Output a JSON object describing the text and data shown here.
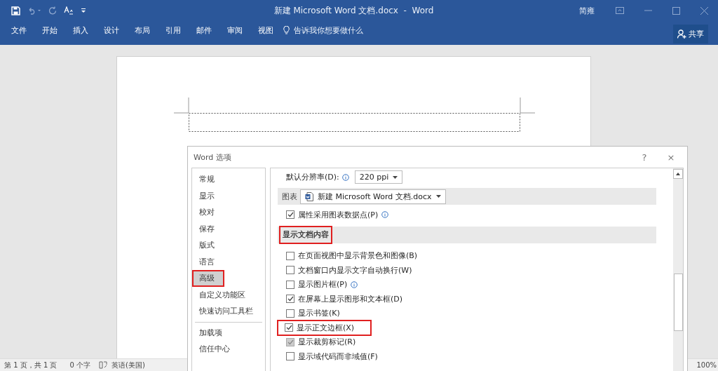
{
  "title_bar": {
    "title": "新建 Microsoft Word 文档.docx  -  Word",
    "user": "简雍"
  },
  "ribbon": {
    "tabs": [
      "文件",
      "开始",
      "插入",
      "设计",
      "布局",
      "引用",
      "邮件",
      "审阅",
      "视图"
    ],
    "tell_me": "告诉我你想要做什么",
    "share": "共享"
  },
  "dialog": {
    "title": "Word 选项",
    "help": "?",
    "close": "×",
    "sidebar": {
      "groups": [
        [
          {
            "label": "常规",
            "selected": false,
            "highlighted": false
          },
          {
            "label": "显示",
            "selected": false,
            "highlighted": false
          },
          {
            "label": "校对",
            "selected": false,
            "highlighted": false
          },
          {
            "label": "保存",
            "selected": false,
            "highlighted": false
          },
          {
            "label": "版式",
            "selected": false,
            "highlighted": false
          },
          {
            "label": "语言",
            "selected": false,
            "highlighted": false
          },
          {
            "label": "高级",
            "selected": true,
            "highlighted": true
          },
          {
            "label": "自定义功能区",
            "selected": false,
            "highlighted": false
          },
          {
            "label": "快速访问工具栏",
            "selected": false,
            "highlighted": false
          }
        ],
        [
          {
            "label": "加载项",
            "selected": false,
            "highlighted": false
          },
          {
            "label": "信任中心",
            "selected": false,
            "highlighted": false
          }
        ]
      ]
    },
    "options": {
      "resolution": {
        "label": "默认分辨率(D):",
        "value": "220 ppi"
      },
      "chart": {
        "label": "图表",
        "document": "新建 Microsoft Word 文档.docx"
      },
      "chart_option": {
        "label": "属性采用图表数据点(P)",
        "checked": true,
        "disabled": false,
        "info": true,
        "highlighted": false
      },
      "section": {
        "title": "显示文档内容",
        "highlighted": true
      },
      "checkboxes": [
        {
          "label": "在页面视图中显示背景色和图像(B)",
          "checked": false,
          "disabled": false,
          "info": false,
          "highlighted": false
        },
        {
          "label": "文档窗口内显示文字自动换行(W)",
          "checked": false,
          "disabled": false,
          "info": false,
          "highlighted": false
        },
        {
          "label": "显示图片框(P)",
          "checked": false,
          "disabled": false,
          "info": true,
          "highlighted": false
        },
        {
          "label": "在屏幕上显示图形和文本框(D)",
          "checked": true,
          "disabled": false,
          "info": false,
          "highlighted": false
        },
        {
          "label": "显示书签(K)",
          "checked": false,
          "disabled": false,
          "info": false,
          "highlighted": false
        },
        {
          "label": "显示正文边框(X)",
          "checked": true,
          "disabled": false,
          "info": false,
          "highlighted": true
        },
        {
          "label": "显示裁剪标记(R)",
          "checked": true,
          "disabled": true,
          "info": false,
          "highlighted": false
        },
        {
          "label": "显示域代码而非域值(F)",
          "checked": false,
          "disabled": false,
          "info": false,
          "highlighted": false
        }
      ]
    }
  },
  "status_bar": {
    "page": "第 1 页，共 1 页",
    "words": "0 个字",
    "language": "英语(美国)",
    "zoom": "100%"
  }
}
